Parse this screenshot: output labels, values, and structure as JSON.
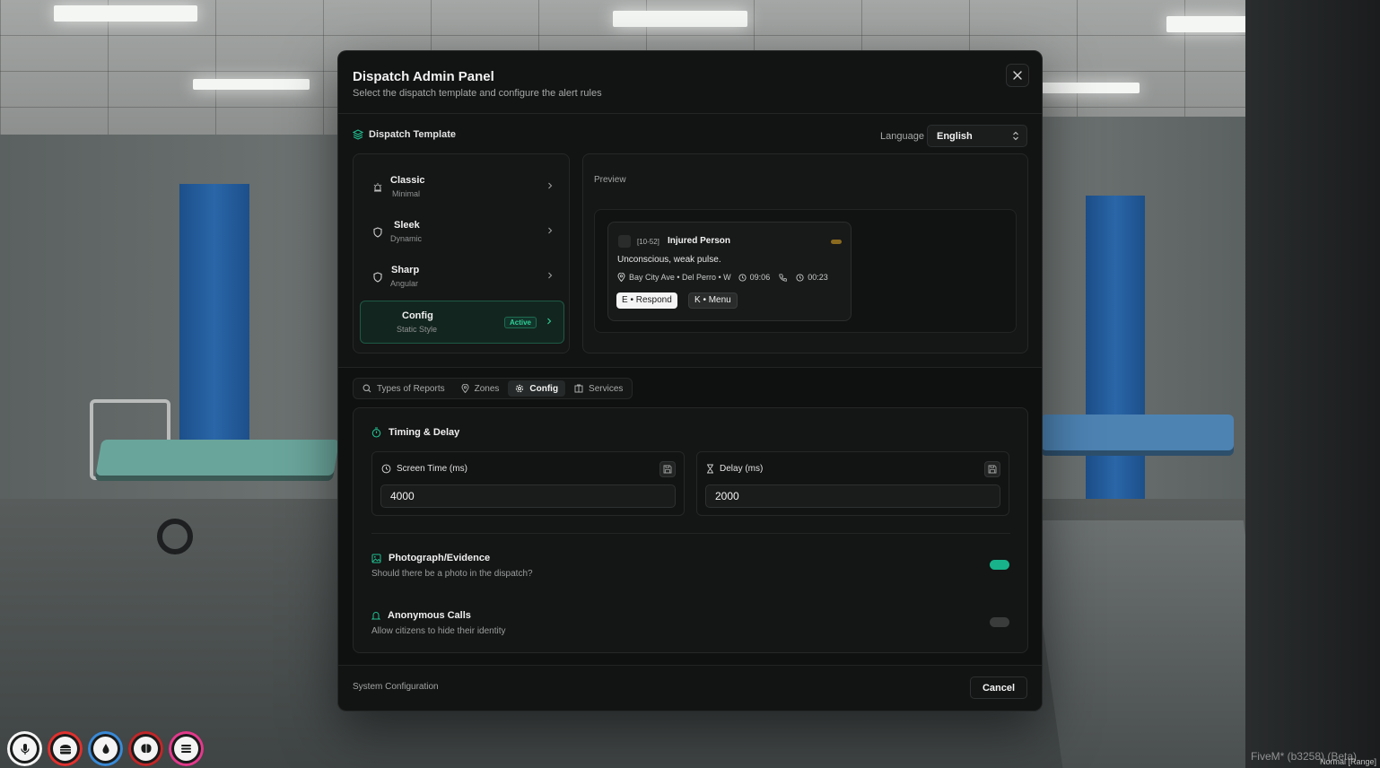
{
  "modal": {
    "title": "Dispatch Admin Panel",
    "subtitle": "Select the dispatch template and configure the alert rules",
    "close_icon": "close-icon"
  },
  "template_section": {
    "heading": "Dispatch Template",
    "language_label": "Language",
    "language_value": "English"
  },
  "templates": [
    {
      "name": "Classic",
      "sub": "Minimal",
      "icon": "siren-icon",
      "active": false
    },
    {
      "name": "Sleek",
      "sub": "Dynamic",
      "icon": "shield-icon",
      "active": false
    },
    {
      "name": "Sharp",
      "sub": "Angular",
      "icon": "shield-icon",
      "active": false
    },
    {
      "name": "Config",
      "sub": "Static Style",
      "icon": "none",
      "active": true,
      "badge": "Active"
    }
  ],
  "preview": {
    "label": "Preview",
    "alert": {
      "code": "[10-52]",
      "title": "Injured Person",
      "description": "Unconscious, weak pulse.",
      "location": "Bay City Ave • Del Perro • W",
      "time": "09:06",
      "call_duration": "00:23",
      "respond_label": "E • Respond",
      "menu_label": "K • Menu"
    }
  },
  "tabs": [
    {
      "label": "Types of Reports",
      "icon": "search-icon",
      "active": false
    },
    {
      "label": "Zones",
      "icon": "map-pin-icon",
      "active": false
    },
    {
      "label": "Config",
      "icon": "gear-icon",
      "active": true
    },
    {
      "label": "Services",
      "icon": "building-icon",
      "active": false
    }
  ],
  "config": {
    "timing_heading": "Timing & Delay",
    "screen_time_label": "Screen Time (ms)",
    "screen_time_value": "4000",
    "delay_label": "Delay (ms)",
    "delay_value": "2000",
    "photo_title": "Photograph/Evidence",
    "photo_desc": "Should there be a photo in the dispatch?",
    "photo_enabled": true,
    "anon_title": "Anonymous Calls",
    "anon_desc": "Allow citizens to hide their identity",
    "anon_enabled": false
  },
  "footer": {
    "text": "System Configuration",
    "cancel_label": "Cancel"
  },
  "hud": {
    "icons": [
      "microphone-icon",
      "burger-icon",
      "water-drop-icon",
      "brain-icon",
      "menu-icon"
    ],
    "ring_colors": [
      "#f4f4f4",
      "#e0322f",
      "#3a8ad6",
      "#c0282a",
      "#e23a8c"
    ]
  },
  "watermark": {
    "build": "FiveM* (b3258) (Beta)",
    "mode": "Normal [Range]"
  },
  "colors": {
    "accent": "#18b38a",
    "active_badge": "#2fcf97"
  }
}
